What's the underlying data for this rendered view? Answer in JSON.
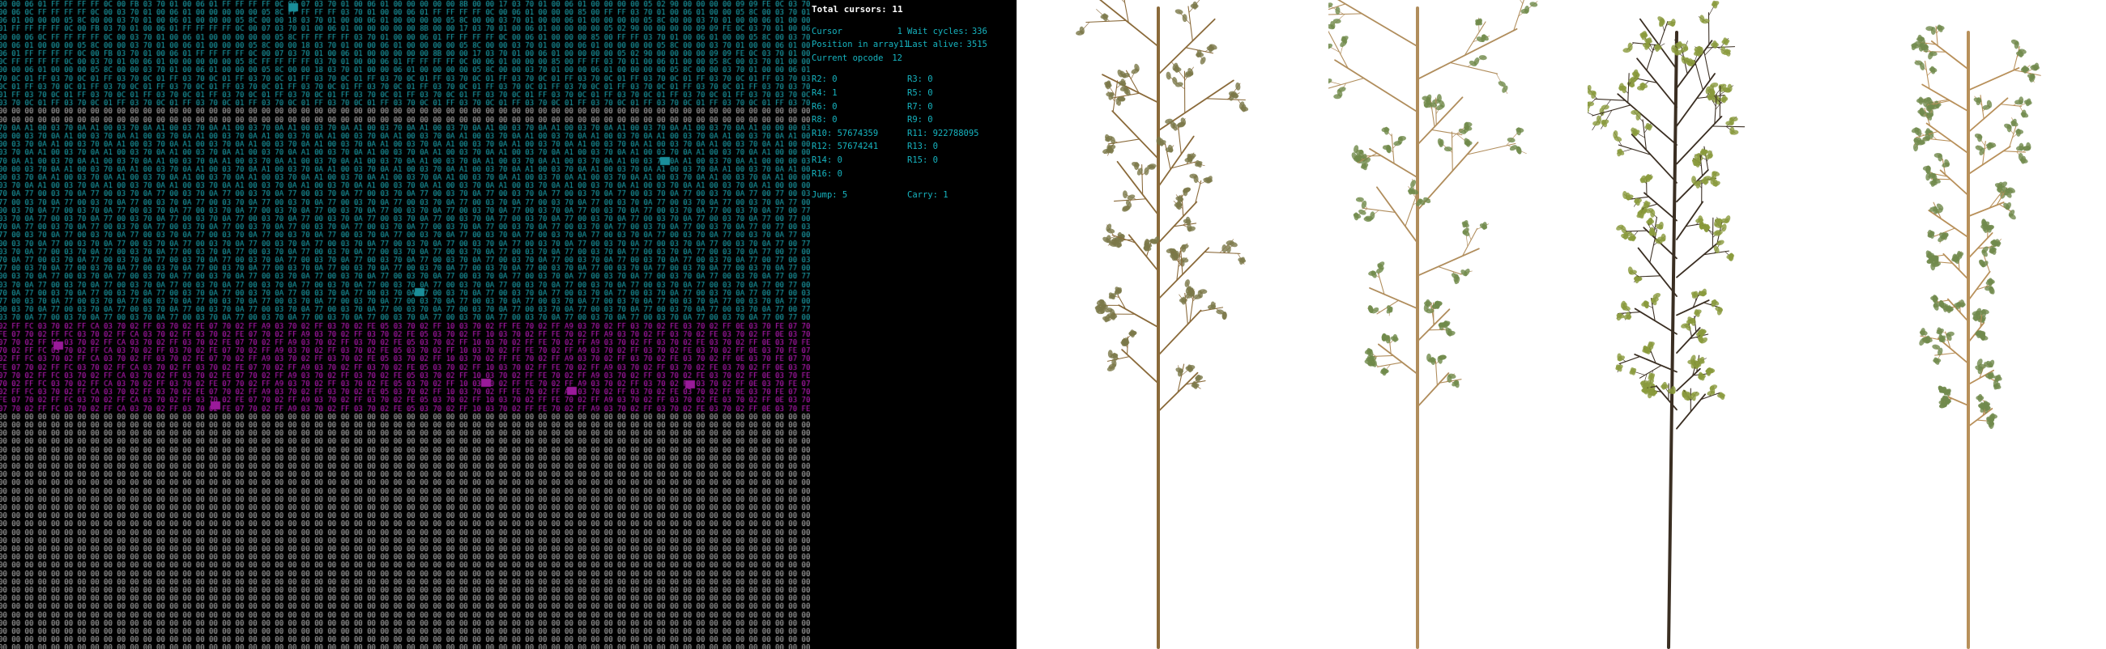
{
  "status": {
    "title": "Total cursors: 11",
    "cursor_label": "Cursor",
    "cursor_value": "1",
    "wait_label": "Wait cycles:",
    "wait_value": "336",
    "position_label": "Position in array",
    "position_value": "11",
    "last_alive_label": "Last alive:",
    "last_alive_value": "3515",
    "opcode_label": "Current opcode",
    "opcode_value": "12",
    "registers": [
      [
        "R2: 0",
        "R3: 0"
      ],
      [
        "R4: 1",
        "R5: 0"
      ],
      [
        "R6: 0",
        "R7: 0"
      ],
      [
        "R8: 0",
        "R9: 0"
      ],
      [
        "R10: 57674359",
        "R11: 922788095"
      ],
      [
        "R12: 57674241",
        "R13: 0"
      ],
      [
        "R14: 0",
        "R15: 0"
      ],
      [
        "R16: 0",
        ""
      ]
    ],
    "jump": "Jump: 5",
    "carry": "Carry: 1"
  },
  "hexdump": {
    "row_templates": [
      "00 00 06 01 FF FF FF FF 0C 00 FB 03 70 01 00 06 01 FF FF FF FF 0C 00 07 03 70 01 00 06 01 00 00 00 00 00 8B 00 00 17 03 70 01 00 06 01 00 00 00 00 05 02 90 00 00 00 00 09 09 FE 0C 03 70 01 00 06",
      "00 00 06 0C FF FF FF FF 0C 00 03 70 01 00 06 01 00 00 00 00 00 05 8C FF FF FF FF 03 70 01 00 00 06 01 FF FF FF FF 0C 00 06 01 00 00 00 85 00 FF FF 03 70 01 00 06 01 00 00 05 8C 00 03 70 01",
      "00 00 06 01 00 00 00 05 8C 00 00 03 70 01 00 06 01 00 00 00 05 8C 00 00 18 03 70 01 00 00 06 01 00 00 00 00 05 8C 00 00 03 70 01 00 00 06 01 00 00 00 00 05 8C 00 00 03 70 01 00 00 06 01",
      "03 70 0C 01 FF 03 70 0C 01 FF 03 70 0C 01 FF 03 70 0C 01 FF 03 70 0C 01 FF 03 70 0C 01 FF 03 70 0C 01 FF 03 70 0C 01 FF 03 70 0C 01 FF 03 70 0C 01 FF 03 70 0C 01 FF 03 70 0C 01 FF 03 70",
      "00 00 00 00 00 00 00 00 00 00 00 00 00 00 00 00 00 00 00 00 00 00 00 00 00 00 00 00 00 00 00 00 00 00 00 00 00 00 00 00 00 00 00 00 00 00 00 00 00 00 00 00 00 00 00 00 00 00 00 00 00 00",
      "00 00 03 70 0A A1 00 03 70 0A A1 00 03 70 0A A1 00 03 70 0A A1 00 03 70 0A A1 00 03 70 0A A1 00 03 70 0A A1 00 03 70 0A A1 00 03 70 0A A1 00 03 70 0A A1 00 03 70 0A A1 00 03 70 0A A1 00",
      "77 00 03 70 0A 77 00 03 70 0A 77 00 03 70 0A 77 00 03 70 0A 77 00 03 70 0A 77 00 03 70 0A 77 00 03 70 0A 77 00 03 70 0A 77 00 03 70 0A 77 00 03 70 0A 77 00 03 70 0A 77 00 03 70 0A 77 00",
      "FE 07 70 02 FF FC 03 70 02 FF CA 03 70 02 FF 03 70 02 FE 07 70 02 FF A9 03 70 02 FF 03 70 02 FE 05 03 70 02 FF 10 03 70 02 FF FE 70 02 FF A9 03 70 02 FF 03 70 02 FE 03 70 02 FF 0E 03 70",
      "00 00 00 00 00 00 00 00 00 00 00 00 00 00 00 00 00 00 00 00 00 00 00 00 00 00 00 00 00 00 00 00 00 00 00 00 00 00 00 00 00 00 00 00 00 00 00 00 00 00 00 00 00 00 00 00 00 00 00 00 00 00"
    ],
    "colors": {
      "background": "#000000",
      "text_dim": "#bfbfbf",
      "text_cyan": "#1fb3bf",
      "text_magenta": "#d01fd0",
      "highlight_cyan_bg": "#1a8e9a",
      "highlight_magenta_bg": "#9a1a9a"
    }
  },
  "plants": [
    {
      "name": "thin-branched-plant",
      "color": "#7a6a40"
    },
    {
      "name": "fern-leaf-plant",
      "color": "#6e7d48"
    },
    {
      "name": "bushy-yellow-green-plant",
      "color": "#7f8a3a"
    },
    {
      "name": "upright-green-plant",
      "color": "#6f8048"
    }
  ]
}
